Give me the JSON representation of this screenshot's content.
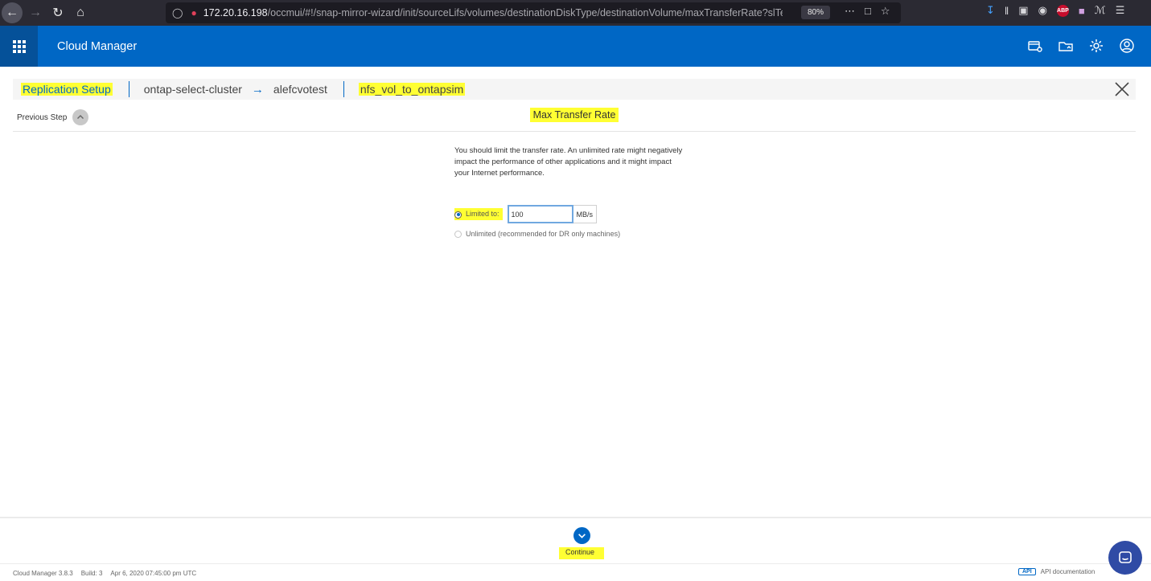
{
  "browser": {
    "url_host": "172.20.16.198",
    "url_path": "/occmui/#!/snap-mirror-wizard/init/sourceLifs/volumes/destinationDiskType/destinationVolume/maxTransferRate?slTenant",
    "zoom": "80%",
    "adblock_label": "ABP"
  },
  "app": {
    "title": "Cloud Manager",
    "brand_color": "#0067c5",
    "highlight_color": "#ffff33"
  },
  "wizard": {
    "breadcrumb": {
      "setup": "Replication Setup",
      "source": "ontap-select-cluster",
      "destination": "alefcvotest",
      "volume": "nfs_vol_to_ontapsim"
    },
    "previous_step": "Previous Step",
    "step_title": "Max Transfer Rate",
    "description": "You should limit the transfer rate. An unlimited rate might negatively impact the performance of other applications and it might impact your Internet performance.",
    "limited_label": "Limited to:",
    "limited_value": "100",
    "unit": "MB/s",
    "unlimited_label": "Unlimited (recommended for DR only machines)",
    "continue_label": "Continue"
  },
  "status": {
    "version": "Cloud Manager 3.8.3",
    "build": "Build: 3",
    "date": "Apr 6, 2020 07:45:00 pm UTC",
    "api_badge": "API",
    "api_docs": "API documentation"
  }
}
